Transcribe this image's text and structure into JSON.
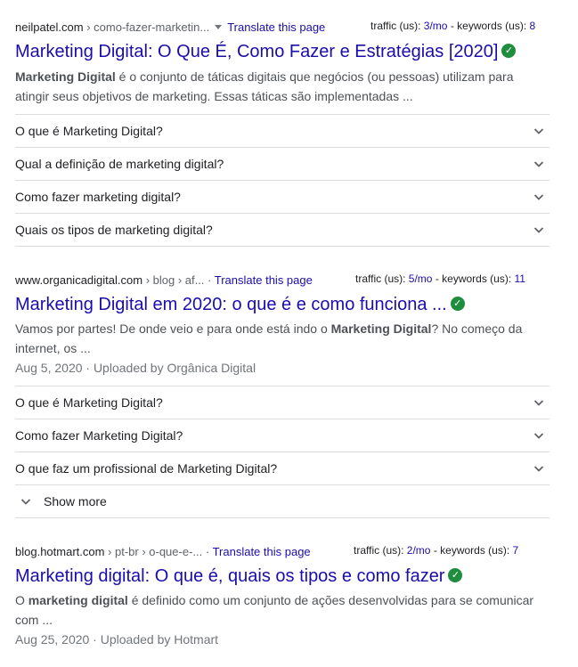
{
  "results": [
    {
      "domain": "neilpatel.com",
      "path": " › como-fazer-marketin...",
      "translate": "Translate this page",
      "traffic_label": "traffic (us): ",
      "traffic_value": "3/mo",
      "keywords_label": " - keywords (us): ",
      "keywords_value": "8",
      "title": "Marketing Digital: O Que É, Como Fazer e Estratégias [2020]",
      "snippet_bold": "Marketing Digital",
      "snippet_rest": " é o conjunto de táticas digitais que negócios (ou pessoas) utilizam para atingir seus objetivos de marketing. Essas táticas são implementadas ...",
      "questions": [
        "O que é Marketing Digital?",
        "Qual a definição de marketing digital?",
        "Como fazer marketing digital?",
        "Quais os tipos de marketing digital?"
      ]
    },
    {
      "domain": "www.organicadigital.com",
      "path": " › blog › af... · ",
      "translate": "Translate this page",
      "traffic_label": "traffic (us): ",
      "traffic_value": "5/mo",
      "keywords_label": " - keywords (us): ",
      "keywords_value": "11",
      "title": "Marketing Digital em 2020: o que é e como funciona ...",
      "snippet_pre": "Vamos por partes! De onde veio e para onde está indo o ",
      "snippet_bold": "Marketing Digital",
      "snippet_rest": "? No começo da internet, os ...",
      "meta": "Aug 5, 2020 · Uploaded by Orgânica Digital",
      "questions": [
        "O que é Marketing Digital?",
        "Como fazer Marketing Digital?",
        "O que faz um profissional de Marketing Digital?"
      ],
      "show_more": "Show more"
    },
    {
      "domain": "blog.hotmart.com",
      "path": " › pt-br › o-que-e-... · ",
      "translate": "Translate this page",
      "traffic_label": "traffic (us): ",
      "traffic_value": "2/mo",
      "keywords_label": " - keywords (us): ",
      "keywords_value": "7",
      "title": "Marketing digital: O que é, quais os tipos e como fazer",
      "snippet_pre": "O ",
      "snippet_bold": "marketing digital",
      "snippet_rest": " é definido como um conjunto de ações desenvolvidas para se comunicar com ...",
      "meta": "Aug 25, 2020 · Uploaded by Hotmart"
    }
  ],
  "colors": {
    "link": "#1a0dab",
    "verified": "#1e8e3e",
    "snippet": "#4d5156",
    "meta": "#70757a",
    "divider": "#dadce0"
  },
  "icons": {
    "verified": "check-circle-icon",
    "expand": "chevron-down-icon",
    "menu": "triangle-down-icon"
  }
}
